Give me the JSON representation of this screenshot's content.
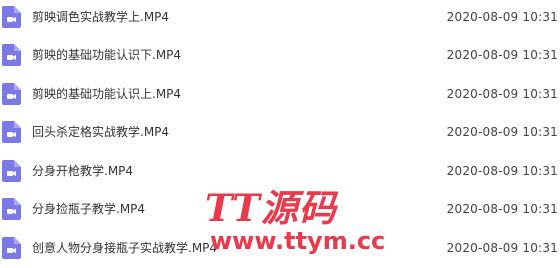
{
  "file_list": {
    "items": [
      {
        "name": "剪映调色实战教学上.MP4",
        "date": "2020-08-09 10:31",
        "icon": "video-file-icon"
      },
      {
        "name": "剪映的基础功能认识下.MP4",
        "date": "2020-08-09 10:31",
        "icon": "video-file-icon"
      },
      {
        "name": "剪映的基础功能认识上.MP4",
        "date": "2020-08-09 10:31",
        "icon": "video-file-icon"
      },
      {
        "name": "回头杀定格实战教学.MP4",
        "date": "2020-08-09 10:31",
        "icon": "video-file-icon"
      },
      {
        "name": "分身开枪教学.MP4",
        "date": "2020-08-09 10:31",
        "icon": "video-file-icon"
      },
      {
        "name": "分身捡瓶子教学.MP4",
        "date": "2020-08-09 10:31",
        "icon": "video-file-icon"
      },
      {
        "name": "创意人物分身接瓶子实战教学.MP4",
        "date": "2020-08-09 10:31",
        "icon": "video-file-icon"
      }
    ]
  },
  "watermark": {
    "brand": "TT源码",
    "url": "www.ttym.cc"
  },
  "colors": {
    "icon": "#7b79e6",
    "watermark": "#e83a4c"
  }
}
